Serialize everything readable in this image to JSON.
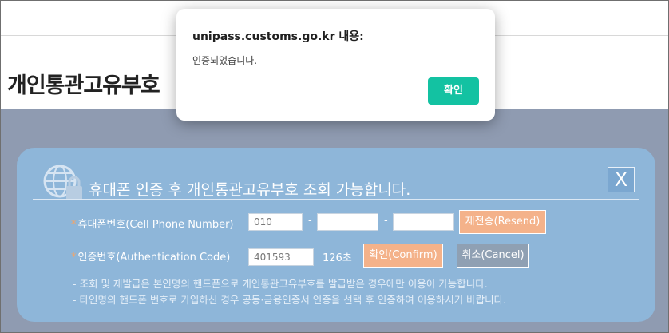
{
  "page": {
    "title": "개인통관고유부호"
  },
  "panel": {
    "heading": "휴대폰 인증 후 개인통관고유부호 조회 가능합니다.",
    "close_glyph": "X",
    "phone": {
      "label": "휴대폰번호(Cell Phone Number)",
      "part1": "010",
      "part2": "",
      "part3": "",
      "separator": "-",
      "resend_label": "재전송(Resend)"
    },
    "auth": {
      "label": "인증번호(Authentication Code)",
      "code": "401593",
      "timer": "126초",
      "confirm_label": "확인(Confirm)",
      "cancel_label": "취소(Cancel)"
    },
    "notes": [
      "- 조회 및 재발급은 본인명의 핸드폰으로 개인통관고유부호를 발급받은 경우에만 이용이 가능합니다.",
      "- 타인명의 핸드폰 번호로 가입하신 경우 공동·금융인증서 인증을 선택 후 인증하여 이용하시기 바랍니다."
    ],
    "required_mark": "*"
  },
  "dialog": {
    "title": "unipass.customs.go.kr 내용:",
    "message": "인증되었습니다.",
    "ok_label": "확인"
  },
  "colors": {
    "overlay": "#8f9bb1",
    "panel": "#8eb6d9",
    "accent_orange": "#f4b28a",
    "dialog_ok": "#13c2a2"
  },
  "icons": [
    "globe-lock-icon",
    "close-icon"
  ]
}
